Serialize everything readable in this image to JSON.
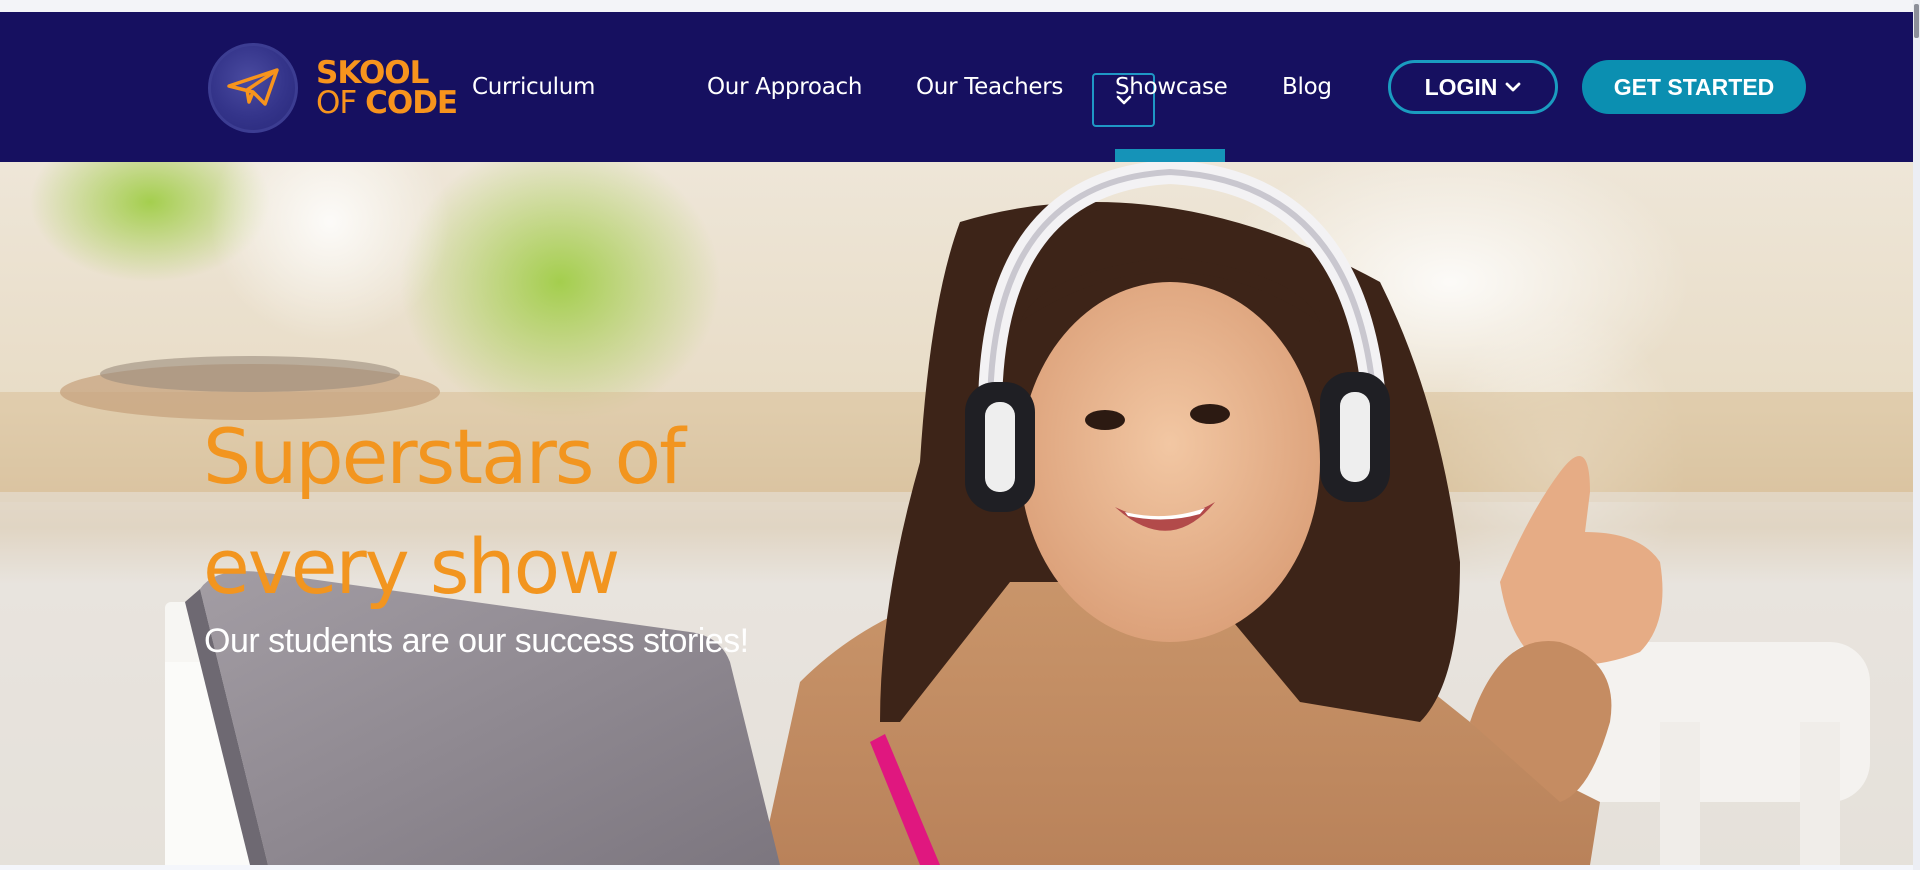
{
  "brand": {
    "line1": "SKOOL",
    "line2_light": "OF",
    "line2_bold": "CODE",
    "primary_color": "#161060",
    "accent_color": "#f7941d",
    "teal_color": "#0b8fb1",
    "logo_icon": "paper-plane-icon"
  },
  "nav": {
    "items": [
      {
        "label": "Curriculum"
      },
      {
        "label": "Our Approach"
      },
      {
        "label": "Our Teachers"
      },
      {
        "label": "Showcase",
        "active": true
      },
      {
        "label": "Blog"
      }
    ],
    "dropdown_icon": "chevron-down-icon"
  },
  "header_actions": {
    "login_label": "LOGIN",
    "login_icon": "chevron-down-icon",
    "get_started_label": "GET STARTED"
  },
  "hero": {
    "title_line1": "Superstars of",
    "title_line2": "every show",
    "subtitle": "Our students are our success stories!"
  }
}
